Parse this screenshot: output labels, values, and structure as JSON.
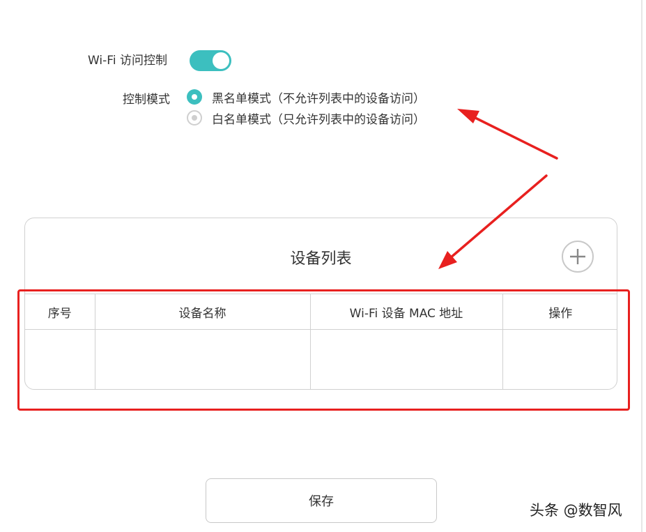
{
  "wifi_access": {
    "label": "Wi-Fi 访问控制",
    "enabled": true
  },
  "control_mode": {
    "label": "控制模式",
    "options": [
      {
        "label": "黑名单模式（不允许列表中的设备访问）",
        "selected": true
      },
      {
        "label": "白名单模式（只允许列表中的设备访问）",
        "selected": false
      }
    ]
  },
  "device_list": {
    "title": "设备列表",
    "add_icon": "plus-icon",
    "columns": [
      "序号",
      "设备名称",
      "Wi-Fi 设备 MAC 地址",
      "操作"
    ],
    "rows": []
  },
  "save_label": "保存",
  "watermark": "头条 @数智风",
  "colors": {
    "accent": "#3cbfbf",
    "annotation_red": "#e8201f",
    "border": "#d0d0d0"
  }
}
